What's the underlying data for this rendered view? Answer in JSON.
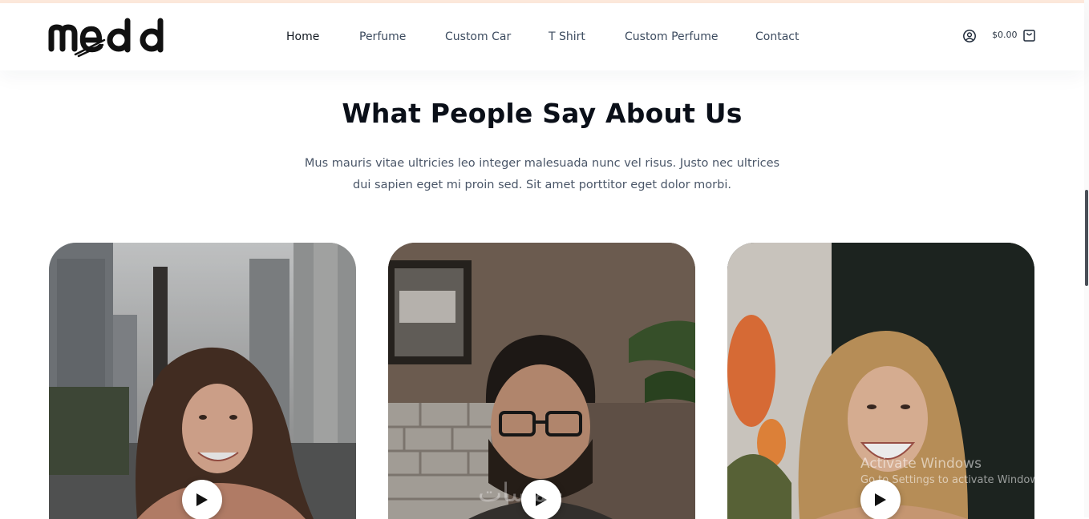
{
  "header": {
    "logo_text": "medd",
    "nav": [
      {
        "label": "Home",
        "active": true
      },
      {
        "label": "Perfume",
        "active": false
      },
      {
        "label": "Custom Car",
        "active": false
      },
      {
        "label": "T Shirt",
        "active": false
      },
      {
        "label": "Custom Perfume",
        "active": false
      },
      {
        "label": "Contact",
        "active": false
      }
    ],
    "account_icon": "user-circle-icon",
    "cart_total": "$0.00",
    "cart_icon": "shopping-bag-icon"
  },
  "testimonials": {
    "title": "What People Say About Us",
    "subtitle": "Mus mauris vitae ultricies leo integer malesuada nunc vel risus. Justo nec ultrices dui sapien eget mi proin sed. Sit amet porttitor eget dolor morbi.",
    "cards": [
      {
        "photo": "smiling woman with brown hair on city street",
        "play_icon": "play-icon"
      },
      {
        "photo": "bearded man with glasses in cafe",
        "play_icon": "play-icon"
      },
      {
        "photo": "laughing woman with blonde wavy hair",
        "play_icon": "play-icon"
      }
    ]
  },
  "overlay": {
    "watermark_text": "خمسات",
    "activate_title": "Activate Windows",
    "activate_sub": "Go to Settings to activate Windows."
  },
  "colors": {
    "top_accent": "#fde9dc",
    "nav_text": "#3c4b5f",
    "title": "#0a0f18"
  }
}
